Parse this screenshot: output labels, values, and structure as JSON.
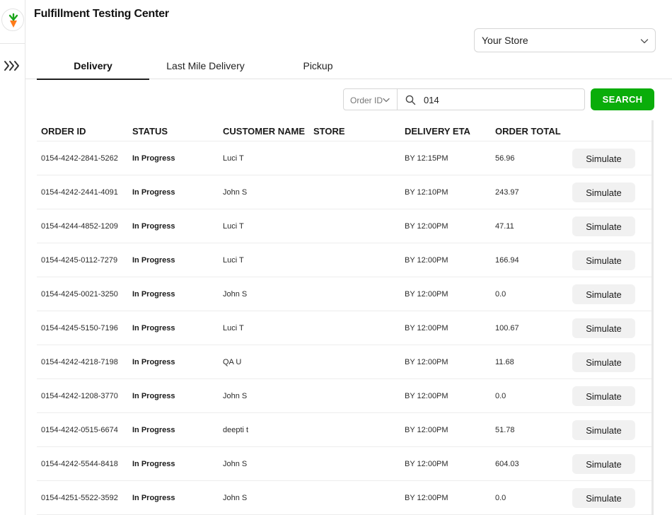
{
  "app": {
    "title": "Fulfillment Testing Center"
  },
  "store_selector": {
    "label": "Your Store"
  },
  "tabs": [
    {
      "label": "Delivery",
      "active": true
    },
    {
      "label": "Last Mile Delivery",
      "active": false
    },
    {
      "label": "Pickup",
      "active": false
    }
  ],
  "search": {
    "type_label": "Order ID",
    "value": "014",
    "button_label": "SEARCH"
  },
  "colors": {
    "accent_green": "#0aad0a",
    "logo_orange": "#ff7a1a",
    "logo_green": "#1aa51a"
  },
  "table": {
    "headers": {
      "order_id": "ORDER ID",
      "status": "STATUS",
      "customer_name": "CUSTOMER NAME",
      "store": "STORE",
      "delivery_eta": "DELIVERY ETA",
      "order_total": "ORDER TOTAL"
    },
    "action_label": "Simulate",
    "rows": [
      {
        "order_id": "0154-4242-2841-5262",
        "status": "In Progress",
        "customer": "Luci T",
        "store": "",
        "eta": "BY 12:15PM",
        "total": "56.96"
      },
      {
        "order_id": "0154-4242-2441-4091",
        "status": "In Progress",
        "customer": "John S",
        "store": "",
        "eta": "BY 12:10PM",
        "total": "243.97"
      },
      {
        "order_id": "0154-4244-4852-1209",
        "status": "In Progress",
        "customer": "Luci T",
        "store": "",
        "eta": "BY 12:00PM",
        "total": "47.11"
      },
      {
        "order_id": "0154-4245-0112-7279",
        "status": "In Progress",
        "customer": "Luci T",
        "store": "",
        "eta": "BY 12:00PM",
        "total": "166.94"
      },
      {
        "order_id": "0154-4245-0021-3250",
        "status": "In Progress",
        "customer": "John S",
        "store": "",
        "eta": "BY 12:00PM",
        "total": "0.0"
      },
      {
        "order_id": "0154-4245-5150-7196",
        "status": "In Progress",
        "customer": "Luci T",
        "store": "",
        "eta": "BY 12:00PM",
        "total": "100.67"
      },
      {
        "order_id": "0154-4242-4218-7198",
        "status": "In Progress",
        "customer": "QA U",
        "store": "",
        "eta": "BY 12:00PM",
        "total": "11.68"
      },
      {
        "order_id": "0154-4242-1208-3770",
        "status": "In Progress",
        "customer": "John S",
        "store": "",
        "eta": "BY 12:00PM",
        "total": "0.0"
      },
      {
        "order_id": "0154-4242-0515-6674",
        "status": "In Progress",
        "customer": "deepti t",
        "store": "",
        "eta": "BY 12:00PM",
        "total": "51.78"
      },
      {
        "order_id": "0154-4242-5544-8418",
        "status": "In Progress",
        "customer": "John S",
        "store": "",
        "eta": "BY 12:00PM",
        "total": "604.03"
      },
      {
        "order_id": "0154-4251-5522-3592",
        "status": "In Progress",
        "customer": "John S",
        "store": "",
        "eta": "BY 12:00PM",
        "total": "0.0"
      }
    ]
  }
}
